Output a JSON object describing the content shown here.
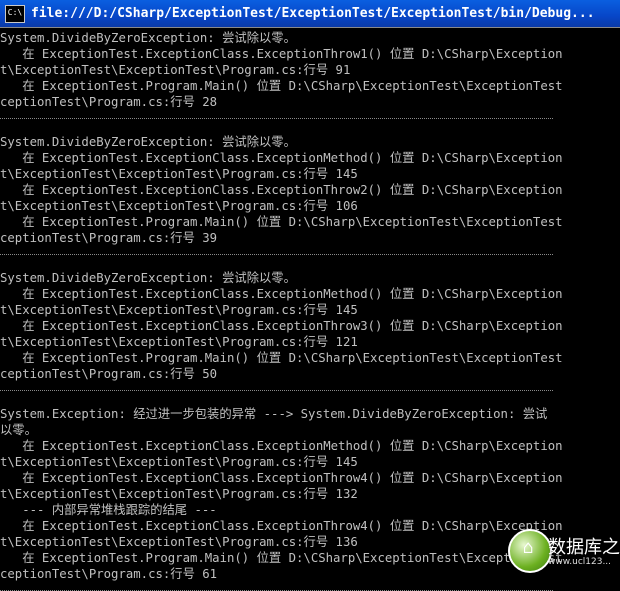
{
  "window": {
    "title": "file:///D:/CSharp/ExceptionTest/ExceptionTest/ExceptionTest/bin/Debug...",
    "icon_label": "C:\\"
  },
  "console_lines": [
    "System.DivideByZeroException: 尝试除以零。",
    "   在 ExceptionTest.ExceptionClass.ExceptionThrow1() 位置 D:\\CSharp\\Exception",
    "t\\ExceptionTest\\ExceptionTest\\Program.cs:行号 91",
    "   在 ExceptionTest.Program.Main() 位置 D:\\CSharp\\ExceptionTest\\ExceptionTest",
    "ceptionTest\\Program.cs:行号 28",
    "---",
    "System.DivideByZeroException: 尝试除以零。",
    "   在 ExceptionTest.ExceptionClass.ExceptionMethod() 位置 D:\\CSharp\\Exception",
    "t\\ExceptionTest\\ExceptionTest\\Program.cs:行号 145",
    "   在 ExceptionTest.ExceptionClass.ExceptionThrow2() 位置 D:\\CSharp\\Exception",
    "t\\ExceptionTest\\ExceptionTest\\Program.cs:行号 106",
    "   在 ExceptionTest.Program.Main() 位置 D:\\CSharp\\ExceptionTest\\ExceptionTest",
    "ceptionTest\\Program.cs:行号 39",
    "---",
    "System.DivideByZeroException: 尝试除以零。",
    "   在 ExceptionTest.ExceptionClass.ExceptionMethod() 位置 D:\\CSharp\\Exception",
    "t\\ExceptionTest\\ExceptionTest\\Program.cs:行号 145",
    "   在 ExceptionTest.ExceptionClass.ExceptionThrow3() 位置 D:\\CSharp\\Exception",
    "t\\ExceptionTest\\ExceptionTest\\Program.cs:行号 121",
    "   在 ExceptionTest.Program.Main() 位置 D:\\CSharp\\ExceptionTest\\ExceptionTest",
    "ceptionTest\\Program.cs:行号 50",
    "---",
    "System.Exception: 经过进一步包装的异常 ---> System.DivideByZeroException: 尝试",
    "以零。",
    "   在 ExceptionTest.ExceptionClass.ExceptionMethod() 位置 D:\\CSharp\\Exception",
    "t\\ExceptionTest\\ExceptionTest\\Program.cs:行号 145",
    "   在 ExceptionTest.ExceptionClass.ExceptionThrow4() 位置 D:\\CSharp\\Exception",
    "t\\ExceptionTest\\ExceptionTest\\Program.cs:行号 132",
    "   --- 内部异常堆栈跟踪的结尾 ---",
    "   在 ExceptionTest.ExceptionClass.ExceptionThrow4() 位置 D:\\CSharp\\Exception",
    "t\\ExceptionTest\\ExceptionTest\\Program.cs:行号 136",
    "   在 ExceptionTest.Program.Main() 位置 D:\\CSharp\\ExceptionTest\\ExceptionTest",
    "ceptionTest\\Program.cs:行号 61",
    "---"
  ],
  "watermark": {
    "text": "数据库之",
    "url": "www.ucl123..."
  },
  "colors": {
    "console_bg": "#000000",
    "console_fg": "#c0c0c0",
    "titlebar": "#0746c8"
  }
}
